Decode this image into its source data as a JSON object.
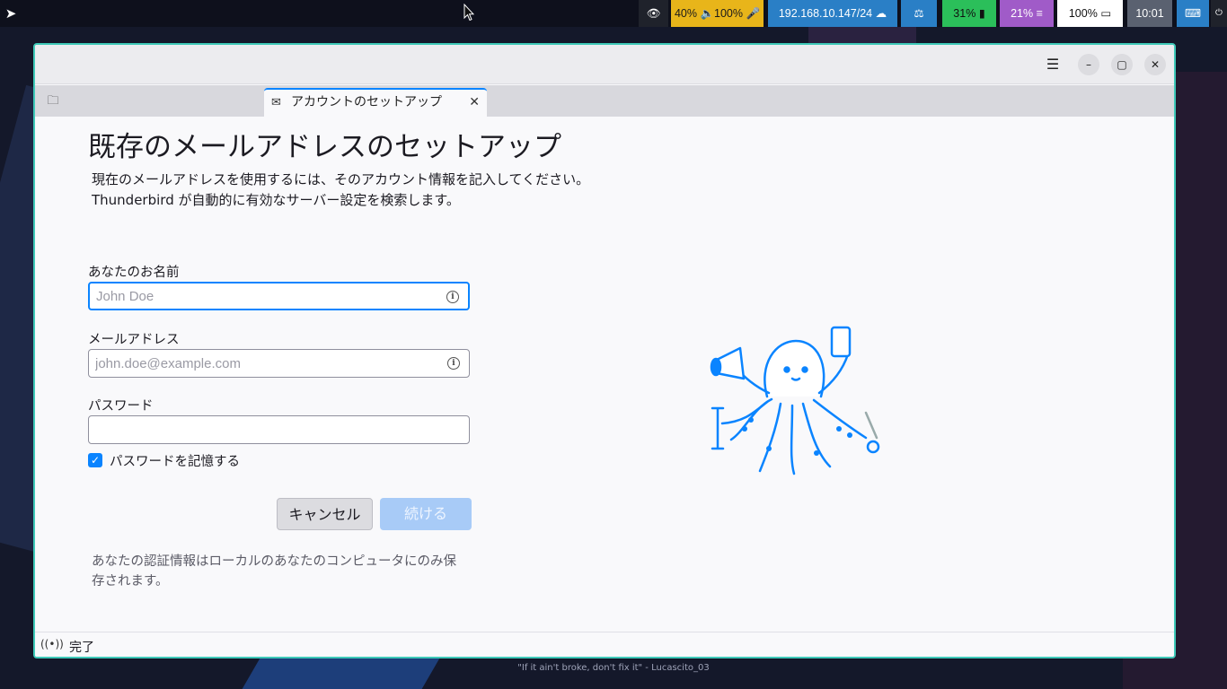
{
  "topbar": {
    "audio_text": "40% 🔈100% 🎤",
    "network_text": "192.168.10.147/24",
    "battery_text": "31%",
    "memory_text": "21%",
    "brightness_text": "100%",
    "clock_text": "10:01"
  },
  "tab": {
    "label": "アカウントのセットアップ",
    "icon": "mail-setup-icon"
  },
  "page": {
    "title": "既存のメールアドレスのセットアップ",
    "description_line1": "現在のメールアドレスを使用するには、そのアカウント情報を記入してください。",
    "description_line2": "Thunderbird が自動的に有効なサーバー設定を検索します。"
  },
  "form": {
    "name_label": "あなたのお名前",
    "name_placeholder": "John Doe",
    "name_value": "",
    "email_label": "メールアドレス",
    "email_placeholder": "john.doe@example.com",
    "email_value": "",
    "password_label": "パスワード",
    "password_value": "",
    "remember_label": "パスワードを記憶する",
    "remember_checked": true,
    "cancel_label": "キャンセル",
    "continue_label": "続ける",
    "note": "あなたの認証情報はローカルのあなたのコンピュータにのみ保存されます。"
  },
  "status": {
    "text": "完了"
  },
  "wallpaper": {
    "quote": "\"If it ain't broke, don't fix it\" - Lucascito_03"
  },
  "colors": {
    "accent": "#0a84ff",
    "window_border": "#3ec9b8",
    "continue_disabled": "#a8cbf7"
  }
}
